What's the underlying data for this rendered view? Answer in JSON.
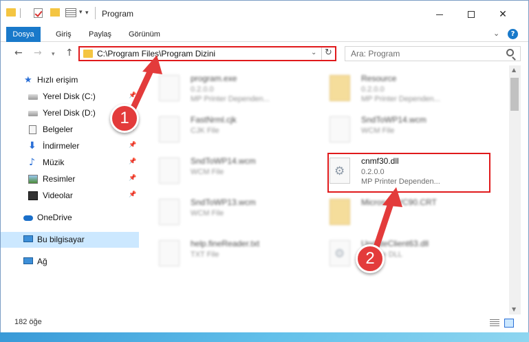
{
  "window": {
    "title": "Program",
    "minimize_icon": "minimize-icon",
    "maximize_icon": "maximize-icon",
    "close_glyph": "✕"
  },
  "ribbon": {
    "tabs": [
      "Dosya",
      "Giriş",
      "Paylaş",
      "Görünüm"
    ],
    "help": "?"
  },
  "address": {
    "path": "C:\\Program Files\\Program Dizini",
    "refresh_glyph": "↻",
    "chevron_glyph": "⌄"
  },
  "search": {
    "placeholder": "Ara: Program"
  },
  "nav": {
    "back": "←",
    "forward": "→",
    "up": "↑",
    "recent": "▾"
  },
  "sidebar": {
    "items": [
      {
        "label": "Hızlı erişim",
        "icon": "star-icon"
      },
      {
        "label": "Yerel Disk (C:)",
        "icon": "disk-icon",
        "pinned": true
      },
      {
        "label": "Yerel Disk (D:)",
        "icon": "disk-icon",
        "pinned": true
      },
      {
        "label": "Belgeler",
        "icon": "document-icon",
        "pinned": true
      },
      {
        "label": "İndirmeler",
        "icon": "download-icon",
        "pinned": true
      },
      {
        "label": "Müzik",
        "icon": "music-icon",
        "pinned": true
      },
      {
        "label": "Resimler",
        "icon": "image-icon",
        "pinned": true
      },
      {
        "label": "Videolar",
        "icon": "video-icon",
        "pinned": true
      },
      {
        "label": "OneDrive",
        "icon": "cloud-icon"
      },
      {
        "label": "Bu bilgisayar",
        "icon": "computer-icon",
        "selected": true
      },
      {
        "label": "Ağ",
        "icon": "network-icon"
      }
    ]
  },
  "files": [
    {
      "name": "program.exe",
      "line1": "0.2.0.0",
      "line2": "MP Printer Dependen...",
      "icon": "exe-icon",
      "blurred": true
    },
    {
      "name": "Resource",
      "line1": "0.2.0.0",
      "line2": "MP Printer Dependen...",
      "icon": "folder-icon",
      "blurred": true
    },
    {
      "name": "FastNrml.cjk",
      "line1": "CJK File",
      "line2": "",
      "icon": "file-icon",
      "blurred": true
    },
    {
      "name": "SndToWP14.wcm",
      "line1": "WCM File",
      "line2": "",
      "icon": "file-icon",
      "blurred": true
    },
    {
      "name": "SndToWP14.wcm",
      "line1": "WCM File",
      "line2": "",
      "icon": "file-icon",
      "blurred": true
    },
    {
      "name": "cnmf30.dll",
      "line1": "0.2.0.0",
      "line2": "MP Printer Dependen...",
      "icon": "dll-gear-icon",
      "blurred": false
    },
    {
      "name": "SndToWP13.wcm",
      "line1": "WCM File",
      "line2": "",
      "icon": "file-icon",
      "blurred": true
    },
    {
      "name": "Microsoft.VC90.CRT",
      "line1": "",
      "line2": "",
      "icon": "folder-icon",
      "blurred": true
    },
    {
      "name": "help.fineReader.txt",
      "line1": "TXT File",
      "line2": "",
      "icon": "file-icon",
      "blurred": true
    },
    {
      "name": "UpdateClient63.dll",
      "line1": "Service DLL",
      "line2": "",
      "icon": "dll-gear-icon",
      "blurred": true
    }
  ],
  "status": {
    "count": "182 öğe"
  },
  "callouts": {
    "one": "1",
    "two": "2"
  },
  "colors": {
    "accent": "#1979ca",
    "highlight_border": "#e0191b",
    "callout": "#e33b3b",
    "selection": "#cce8ff"
  }
}
